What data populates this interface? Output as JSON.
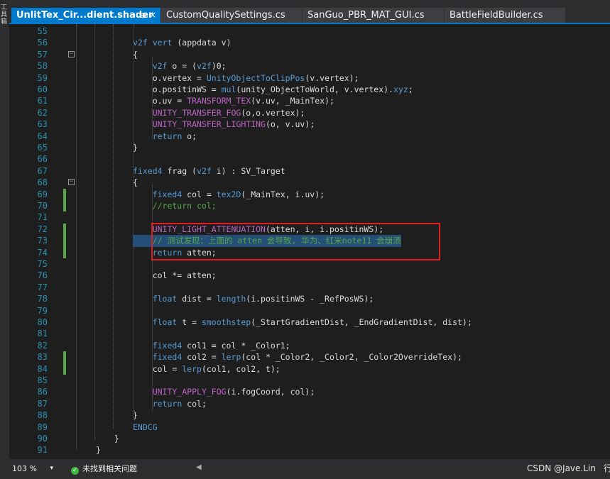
{
  "left_panel": {
    "label": "工具箱"
  },
  "tabs": [
    {
      "label": "UnlitTex_Cir...dient.shader",
      "active": true,
      "pin": "⊕",
      "close": "×"
    },
    {
      "label": "CustomQualitySettings.cs"
    },
    {
      "label": "SanGuo_PBR_MAT_GUI.cs"
    },
    {
      "label": "BattleFieldBuilder.cs"
    }
  ],
  "code_lines": [
    {
      "n": "55",
      "t": ""
    },
    {
      "n": "56",
      "t": "v2f vert (appdata v)"
    },
    {
      "n": "57",
      "t": "{"
    },
    {
      "n": "58",
      "t": "    v2f o = (v2f)0;"
    },
    {
      "n": "59",
      "t": "    o.vertex = UnityObjectToClipPos(v.vertex);"
    },
    {
      "n": "60",
      "t": "    o.positinWS = mul(unity_ObjectToWorld, v.vertex).xyz;"
    },
    {
      "n": "61",
      "t": "    o.uv = TRANSFORM_TEX(v.uv, _MainTex);"
    },
    {
      "n": "62",
      "t": "    UNITY_TRANSFER_FOG(o,o.vertex);"
    },
    {
      "n": "63",
      "t": "    UNITY_TRANSFER_LIGHTING(o, v.uv);"
    },
    {
      "n": "64",
      "t": "    return o;"
    },
    {
      "n": "65",
      "t": "}"
    },
    {
      "n": "66",
      "t": ""
    },
    {
      "n": "67",
      "t": "fixed4 frag (v2f i) : SV_Target"
    },
    {
      "n": "68",
      "t": "{"
    },
    {
      "n": "69",
      "t": "    fixed4 col = tex2D(_MainTex, i.uv);"
    },
    {
      "n": "70",
      "t": "    //return col;"
    },
    {
      "n": "71",
      "t": ""
    },
    {
      "n": "72",
      "t": "    UNITY_LIGHT_ATTENUATION(atten, i, i.positinWS);"
    },
    {
      "n": "73",
      "t": "    // 测试发现：上面的 atten 会导致, 华为、红米note11 会崩溃"
    },
    {
      "n": "74",
      "t": "    return atten;"
    },
    {
      "n": "75",
      "t": ""
    },
    {
      "n": "76",
      "t": "    col *= atten;"
    },
    {
      "n": "77",
      "t": ""
    },
    {
      "n": "78",
      "t": "    float dist = length(i.positinWS - _RefPosWS);"
    },
    {
      "n": "79",
      "t": ""
    },
    {
      "n": "80",
      "t": "    float t = smoothstep(_StartGradientDist, _EndGradientDist, dist);"
    },
    {
      "n": "81",
      "t": ""
    },
    {
      "n": "82",
      "t": "    fixed4 col1 = col * _Color1;"
    },
    {
      "n": "83",
      "t": "    fixed4 col2 = lerp(col * _Color2, _Color2, _Color2OverrideTex);"
    },
    {
      "n": "84",
      "t": "    col = lerp(col1, col2, t);"
    },
    {
      "n": "85",
      "t": ""
    },
    {
      "n": "86",
      "t": "    UNITY_APPLY_FOG(i.fogCoord, col);"
    },
    {
      "n": "87",
      "t": "    return col;"
    },
    {
      "n": "88",
      "t": "}"
    },
    {
      "n": "89",
      "t": "ENDCG"
    },
    {
      "n": "90",
      "t": "}"
    },
    {
      "n": "91",
      "t": "}"
    }
  ],
  "status_bar": {
    "zoom": "103 %",
    "zoom_dropdown": "▾",
    "issues": "未找到相关问题",
    "issues_icon": "✓",
    "scroll_left": "◀",
    "watermark": "CSDN @Jave.Lin",
    "row": "行"
  },
  "colors": {
    "accent": "#007acc",
    "change_bar": "#57a64a",
    "highlight_box": "#e02020",
    "selection": "#264f78"
  }
}
